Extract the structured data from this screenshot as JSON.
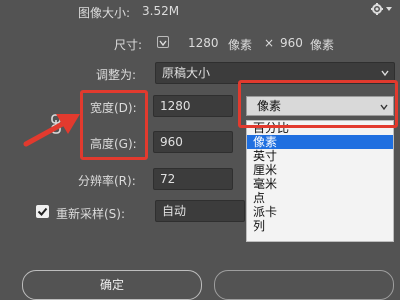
{
  "image_size": {
    "label": "图像大小:",
    "value": "3.52M"
  },
  "dimensions": {
    "label": "尺寸:",
    "width": "1280",
    "unit1": "像素",
    "times": "×",
    "height": "960",
    "unit2": "像素"
  },
  "fit_to": {
    "label": "调整为:",
    "value": "原稿大小"
  },
  "width_field": {
    "label": "宽度(D):",
    "value": "1280"
  },
  "height_field": {
    "label": "高度(G):",
    "value": "960"
  },
  "resolution": {
    "label": "分辨率(R):",
    "value": "72"
  },
  "resample": {
    "label": "重新采样(S):",
    "value": "自动",
    "checked": true
  },
  "unit_select": {
    "value": "像素"
  },
  "unit_options": [
    "百分比",
    "像素",
    "英寸",
    "厘米",
    "毫米",
    "点",
    "派卡",
    "列"
  ],
  "buttons": {
    "ok": "确定"
  },
  "colors": {
    "accent_red": "#e23a2e",
    "selection_blue": "#1f6fe0",
    "panel": "#535353"
  }
}
